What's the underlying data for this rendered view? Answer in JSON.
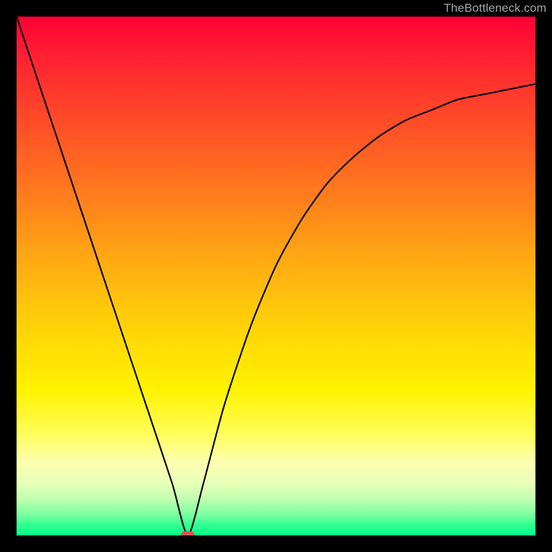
{
  "watermark": "TheBottleneck.com",
  "chart_data": {
    "type": "line",
    "title": "",
    "xlabel": "",
    "ylabel": "",
    "xlim": [
      0,
      100
    ],
    "ylim": [
      0,
      100
    ],
    "min_x": 33,
    "min_y": 0,
    "marker_color": "#d9534f",
    "gradient_stops": [
      {
        "pos": 0,
        "color": "#ff0033"
      },
      {
        "pos": 6,
        "color": "#ff1a33"
      },
      {
        "pos": 15,
        "color": "#ff3a2c"
      },
      {
        "pos": 25,
        "color": "#ff5c24"
      },
      {
        "pos": 35,
        "color": "#ff7e1c"
      },
      {
        "pos": 45,
        "color": "#ffa314"
      },
      {
        "pos": 55,
        "color": "#ffc40c"
      },
      {
        "pos": 65,
        "color": "#ffe104"
      },
      {
        "pos": 72,
        "color": "#fff200"
      },
      {
        "pos": 80,
        "color": "#fffd55"
      },
      {
        "pos": 86,
        "color": "#fcffb0"
      },
      {
        "pos": 90,
        "color": "#e8ffb8"
      },
      {
        "pos": 93,
        "color": "#bfffb0"
      },
      {
        "pos": 96,
        "color": "#7affa0"
      },
      {
        "pos": 98,
        "color": "#2fff90"
      },
      {
        "pos": 100,
        "color": "#00ff88"
      }
    ],
    "series": [
      {
        "name": "curve",
        "x": [
          0,
          5,
          10,
          15,
          20,
          25,
          30,
          33,
          36,
          40,
          45,
          50,
          55,
          60,
          65,
          70,
          75,
          80,
          85,
          90,
          95,
          100
        ],
        "y": [
          100,
          85,
          70,
          55,
          40,
          25,
          10,
          0,
          10,
          25,
          40,
          52,
          61,
          68,
          73,
          77,
          80,
          82,
          84,
          85,
          86,
          87
        ]
      }
    ]
  }
}
